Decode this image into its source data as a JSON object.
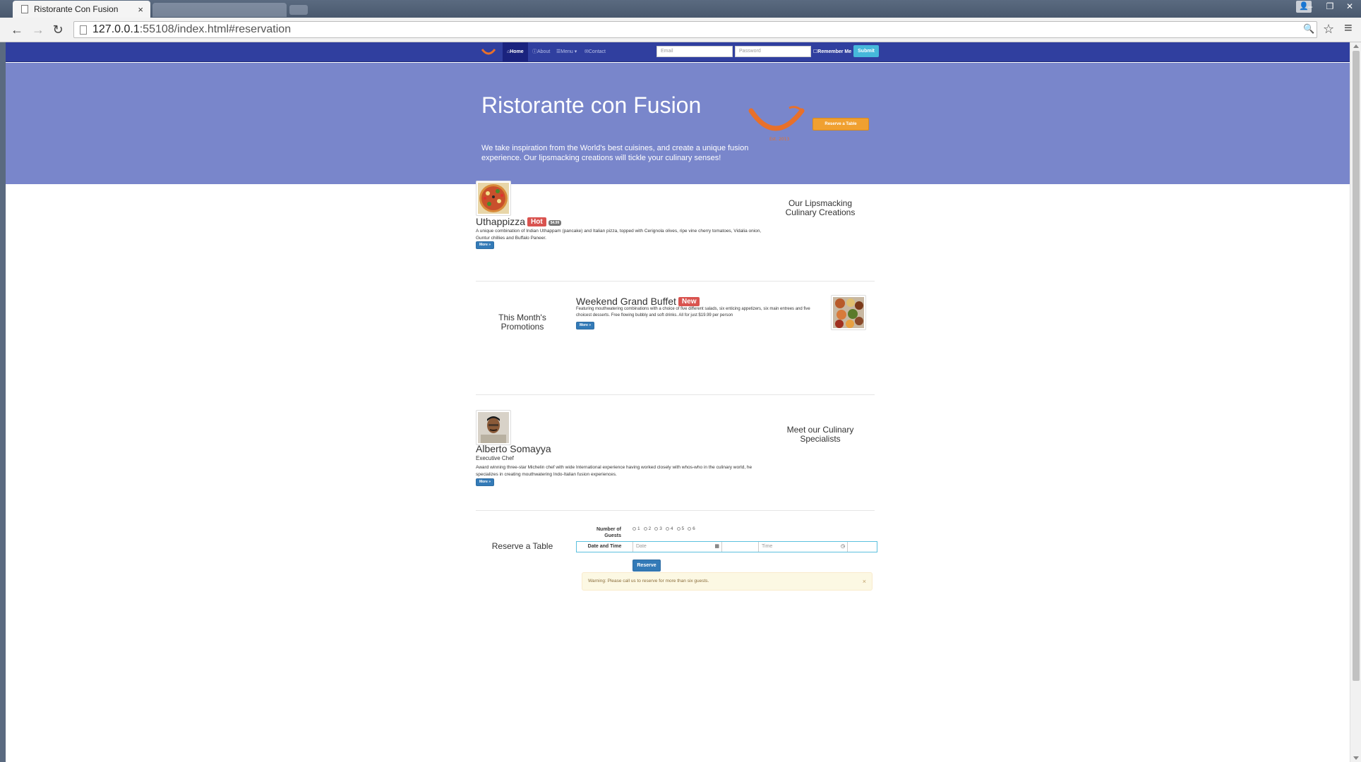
{
  "browser": {
    "tab_title": "Ristorante Con Fusion",
    "tab_close": "×",
    "url_host": "127.0.0.1",
    "url_path": ":55108/index.html#reservation",
    "back": "←",
    "forward": "→",
    "reload": "↻",
    "zoom_icon": "🔍",
    "star_icon": "☆",
    "menu_icon": "≡",
    "win_min": "–",
    "win_max": "❐",
    "win_close": "✕",
    "win_user": "👤"
  },
  "navbar": {
    "items": [
      {
        "label": "Home",
        "icon": "home-icon",
        "glyph": "⌂",
        "active": true
      },
      {
        "label": "About",
        "icon": "info-icon",
        "glyph": "ⓘ",
        "active": false
      },
      {
        "label": "Menu",
        "icon": "list-icon",
        "glyph": "☰",
        "caret": "▾",
        "active": false
      },
      {
        "label": "Contact",
        "icon": "envelope-icon",
        "glyph": "✉",
        "active": false
      }
    ],
    "email_placeholder": "Email",
    "password_placeholder": "Password",
    "remember_label": "Remember Me",
    "submit_label": "Submit",
    "colors": {
      "navbar": "#303f9f",
      "active": "#1a237e"
    }
  },
  "jumbotron": {
    "title": "Ristorante con Fusion",
    "text": "We take inspiration from the World's best cuisines, and create a unique fusion experience. Our lipsmacking creations will tickle your culinary senses!",
    "reserve_button": "Reserve a Table",
    "logo_est": "Est. 2013",
    "colors": {
      "background": "#7986cb",
      "button": "#f0a030"
    }
  },
  "dish": {
    "name": "Uthappizza",
    "badge": "Hot",
    "price": "$4.99",
    "description": "A unique combination of Indian Uthappam (pancake) and Italian pizza, topped with Cerignola olives, ripe vine cherry tomatoes, Vidalia onion, Guntur chillies and Buffalo Paneer.",
    "more": "More »",
    "side_title": "Our Lipsmacking Culinary Creations"
  },
  "promotion": {
    "side_title": "This Month's Promotions",
    "name": "Weekend Grand Buffet",
    "badge": "New",
    "description": "Featuring mouthwatering combinations with a choice of five different salads, six enticing appetizers, six main entrees and five choicest desserts. Free flowing bubbly and soft drinks. All for just $19.99 per person",
    "more": "More »"
  },
  "leader": {
    "name": "Alberto Somayya",
    "designation": "Executive Chef",
    "description": "Award winning three-star Michelin chef with wide International experience having worked closely with whos-who in the culinary world, he specializes in creating mouthwatering Indo-Italian fusion experiences.",
    "more": "More »",
    "side_title": "Meet our Culinary Specialists"
  },
  "reservation": {
    "side_title": "Reserve a Table",
    "guests_label": "Number of Guests",
    "guest_options": [
      "1",
      "2",
      "3",
      "4",
      "5",
      "6"
    ],
    "datetime_label": "Date and Time",
    "date_placeholder": "Date",
    "time_placeholder": "Time",
    "calendar_glyph": "▦",
    "clock_glyph": "◷",
    "submit_label": "Reserve",
    "warning": "Warning: Please call us to reserve for more than six guests.",
    "warning_close": "×"
  }
}
